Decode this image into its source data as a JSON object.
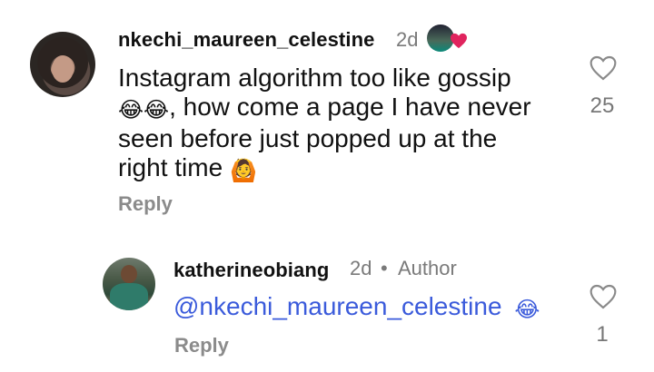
{
  "comments": [
    {
      "username": "nkechi_maureen_celestine",
      "time": "2d",
      "text_lines": [
        "Instagram algorithm  too like gossip",
        ", how come a page I have never",
        "seen before just popped up at the",
        "right time"
      ],
      "emojis_line2": "😂😂",
      "emoji_line4": "🙆",
      "reply_label": "Reply",
      "like_count": "25"
    },
    {
      "username": "katherineobiang",
      "time": "2d",
      "separator": "•",
      "author_label": "Author",
      "mention": "@nkechi_maureen_celestine",
      "emoji": "😂",
      "reply_label": "Reply",
      "like_count": "1"
    }
  ],
  "icons": {
    "like": "heart-outline-icon",
    "liked_by_author": "red-heart-icon"
  },
  "colors": {
    "mention": "#3b5bdb",
    "liked_heart": "#e0245e",
    "muted": "#7a7a7a"
  }
}
